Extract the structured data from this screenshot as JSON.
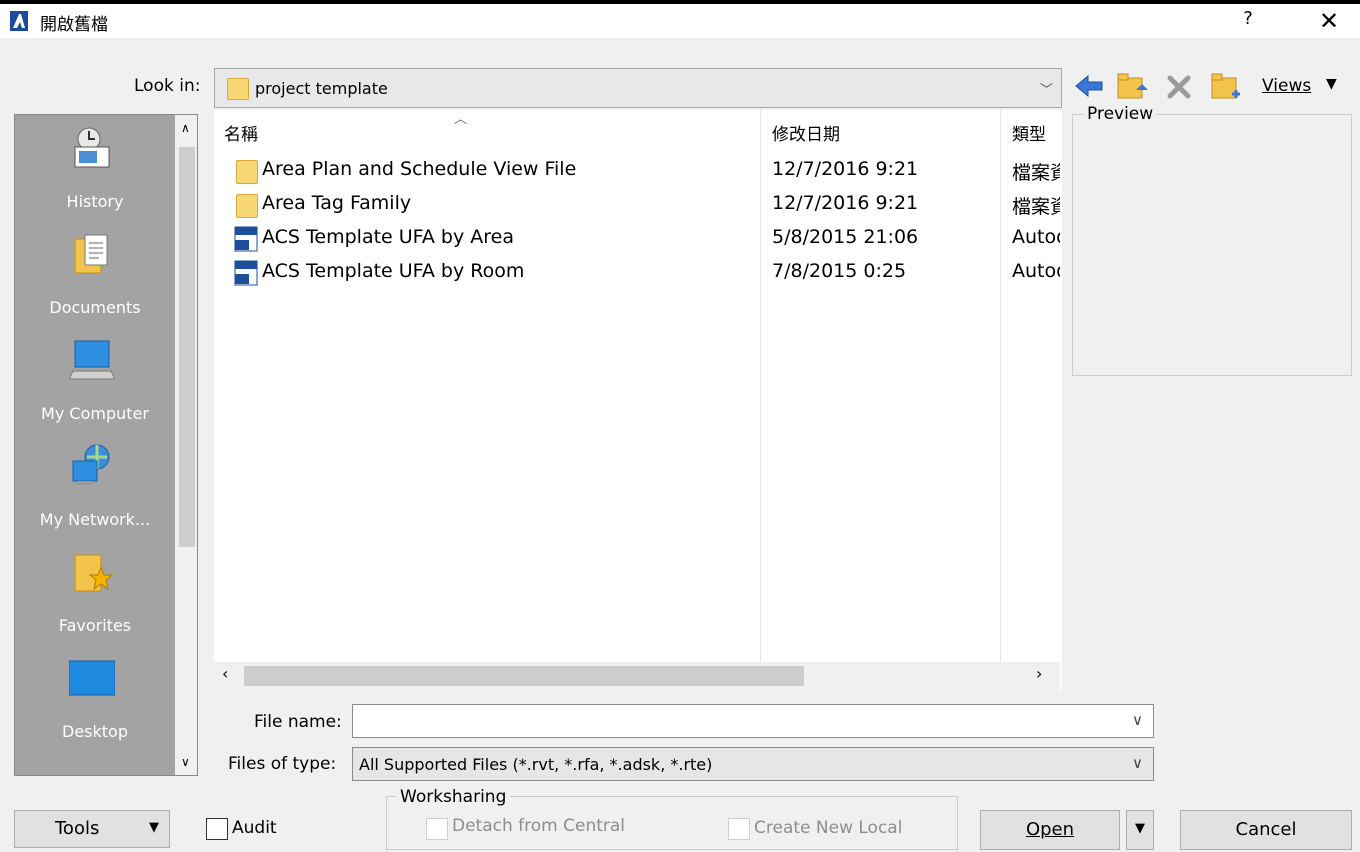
{
  "window": {
    "title": "開啟舊檔",
    "help": "?",
    "close": "✕"
  },
  "lookin": {
    "label": "Look in:",
    "value": "project template"
  },
  "toolbar": {
    "views_label": "Views"
  },
  "places": [
    {
      "label": "History",
      "icon": "history-icon"
    },
    {
      "label": "Documents",
      "icon": "documents-icon"
    },
    {
      "label": "My Computer",
      "icon": "my-computer-icon"
    },
    {
      "label": "My Network...",
      "icon": "my-network-icon"
    },
    {
      "label": "Favorites",
      "icon": "favorites-icon"
    },
    {
      "label": "Desktop",
      "icon": "desktop-icon"
    }
  ],
  "columns": {
    "name": "名稱",
    "date": "修改日期",
    "type": "類型"
  },
  "files": [
    {
      "name": "Area Plan and Schedule View File",
      "date": "12/7/2016 9:21",
      "type": "檔案資料夾",
      "icon": "folder-icon"
    },
    {
      "name": "Area Tag Family",
      "date": "12/7/2016 9:21",
      "type": "檔案資料夾",
      "icon": "folder-icon"
    },
    {
      "name": "ACS Template UFA by Area",
      "date": "5/8/2015 21:06",
      "type": "Autodesk",
      "icon": "rte-file-icon"
    },
    {
      "name": "ACS Template UFA by Room",
      "date": "7/8/2015 0:25",
      "type": "Autodesk",
      "icon": "rte-file-icon"
    }
  ],
  "preview": {
    "label": "Preview"
  },
  "filename": {
    "label": "File name:",
    "value": ""
  },
  "filetype": {
    "label": "Files of type:",
    "value": "All Supported Files  (*.rvt, *.rfa, *.adsk, *.rte)"
  },
  "bottom": {
    "tools_label": "Tools",
    "audit_label": "Audit",
    "worksharing_label": "Worksharing",
    "detach_label": "Detach from Central",
    "create_local_label": "Create New Local",
    "open_label": "Open",
    "cancel_label": "Cancel"
  }
}
